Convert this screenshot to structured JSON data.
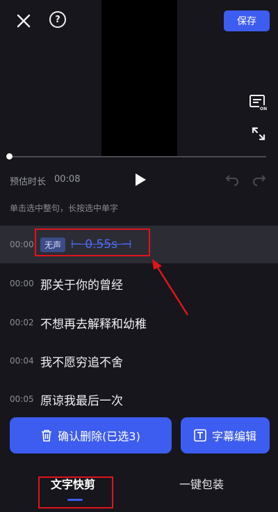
{
  "header": {
    "close_icon": "close-icon",
    "help_icon": "help-icon",
    "help_glyph": "?",
    "save_label": "保存"
  },
  "player": {
    "progress": 0.0,
    "duration_label": "预估时长",
    "duration_value": "00:08",
    "hint": "单击选中整句，长按选中单字"
  },
  "segments": [
    {
      "time": "00:00",
      "silent": true,
      "badge": "无声",
      "duration": "⊢ 0.55s ⊣"
    },
    {
      "time": "00:00",
      "text": "那关于你的曾经"
    },
    {
      "time": "00:02",
      "text": "不想再去解释和幼稚"
    },
    {
      "time": "00:04",
      "text": "我不愿穷追不舍"
    },
    {
      "time": "00:05",
      "text": "原谅我最后一次"
    }
  ],
  "actions": {
    "confirm_delete": "确认删除(已选3)",
    "subtitle_edit": "字幕编辑"
  },
  "tabs": {
    "quick_cut": "文字快剪",
    "one_click_pack": "一键包装"
  },
  "colors": {
    "accent": "#3d5cf0",
    "annotation": "#e0141b",
    "background": "#16161c"
  }
}
